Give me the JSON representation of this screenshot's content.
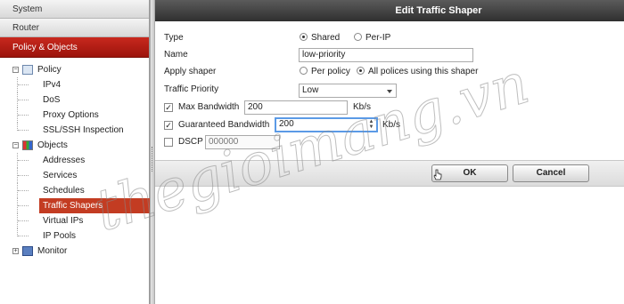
{
  "sidebar": {
    "sections": {
      "system": "System",
      "router": "Router",
      "policy_objects": "Policy & Objects"
    },
    "policy_group": "Policy",
    "policy_items": [
      "IPv4",
      "DoS",
      "Proxy Options",
      "SSL/SSH Inspection"
    ],
    "objects_group": "Objects",
    "objects_items": [
      "Addresses",
      "Services",
      "Schedules",
      "Traffic Shapers",
      "Virtual IPs",
      "IP Pools"
    ],
    "selected_item": "Traffic Shapers",
    "monitor_group": "Monitor"
  },
  "dialog": {
    "title": "Edit Traffic Shaper",
    "type": {
      "label": "Type",
      "options": [
        "Shared",
        "Per-IP"
      ],
      "selected": "Shared"
    },
    "name": {
      "label": "Name",
      "value": "low-priority"
    },
    "apply_shaper": {
      "label": "Apply shaper",
      "options": [
        "Per policy",
        "All polices using this shaper"
      ],
      "selected": "All polices using this shaper"
    },
    "traffic_priority": {
      "label": "Traffic Priority",
      "value": "Low"
    },
    "max_bandwidth": {
      "label": "Max Bandwidth",
      "value": "200",
      "unit": "Kb/s",
      "checked": true
    },
    "guaranteed_bandwidth": {
      "label": "Guaranteed Bandwidth",
      "value": "200",
      "unit": "Kb/s",
      "checked": true
    },
    "dscp": {
      "label": "DSCP",
      "value": "000000",
      "checked": false
    },
    "buttons": {
      "ok": "OK",
      "cancel": "Cancel"
    }
  },
  "watermark": "thegioimang.vn",
  "colors": {
    "accent_red": "#b81e14",
    "selected_row": "#c33c22",
    "title_bar": "#3a3a3a",
    "focus_border": "#5b9ae6"
  }
}
